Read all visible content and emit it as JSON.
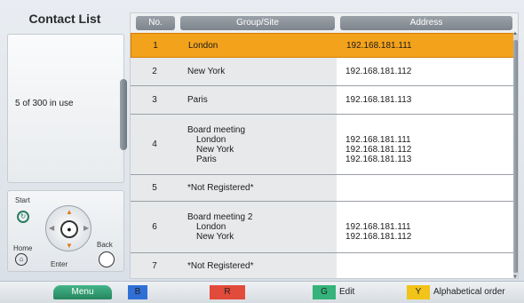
{
  "title": "Contact List",
  "usage": "5 of 300 in use",
  "table": {
    "headers": {
      "no": "No.",
      "group": "Group/Site",
      "address": "Address"
    },
    "rows": [
      {
        "no": "1",
        "group_lines": [
          "London"
        ],
        "address_lines": [
          "192.168.181.111"
        ],
        "selected": true
      },
      {
        "no": "2",
        "group_lines": [
          "New York"
        ],
        "address_lines": [
          "192.168.181.112"
        ]
      },
      {
        "no": "3",
        "group_lines": [
          "Paris"
        ],
        "address_lines": [
          "192.168.181.113"
        ]
      },
      {
        "no": "4",
        "group_lines": [
          "Board meeting",
          "London",
          "New York",
          "Paris"
        ],
        "address_lines": [
          "",
          "192.168.181.111",
          "192.168.181.112",
          "192.168.181.113"
        ]
      },
      {
        "no": "5",
        "group_lines": [
          "*Not Registered*"
        ],
        "address_lines": []
      },
      {
        "no": "6",
        "group_lines": [
          "Board meeting 2",
          "London",
          "New York"
        ],
        "address_lines": [
          "",
          "192.168.181.111",
          "192.168.181.112"
        ]
      },
      {
        "no": "7",
        "group_lines": [
          "*Not Registered*"
        ],
        "address_lines": []
      }
    ]
  },
  "remote": {
    "start": "Start",
    "home": "Home",
    "back": "Back",
    "enter": "Enter"
  },
  "bottom_bar": {
    "menu": "Menu",
    "keys": [
      {
        "key": "B",
        "color": "#2f6fd6",
        "label": ""
      },
      {
        "key": "R",
        "color": "#e24a3b",
        "label": ""
      },
      {
        "key": "G",
        "color": "#35b37a",
        "label": "Edit"
      },
      {
        "key": "Y",
        "color": "#f2c318",
        "label": "Alphabetical order"
      }
    ]
  },
  "colors": {
    "selected_row": "#f3a21c",
    "header_bg": "#8a9198"
  }
}
